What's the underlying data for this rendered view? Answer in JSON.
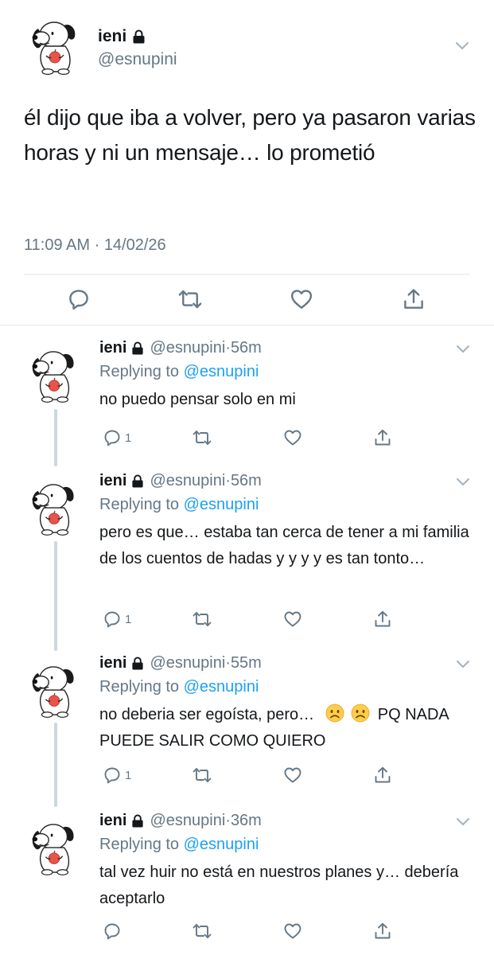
{
  "main_tweet": {
    "name": "ieni",
    "handle": "@esnupini",
    "text": "él dijo que iba a volver, pero ya pasaron varias horas y ni un mensaje… lo prometió",
    "time": "11:09 AM",
    "separator": " · ",
    "date": "14/02/26"
  },
  "replies": [
    {
      "name": "ieni",
      "handle": "@esnupini",
      "dot": "·",
      "time": "56m",
      "replying_prefix": "Replying to ",
      "replying_to": "@esnupini",
      "text": "no puedo pensar solo en mi",
      "reply_count": "1"
    },
    {
      "name": "ieni",
      "handle": "@esnupini",
      "dot": "·",
      "time": "56m",
      "replying_prefix": "Replying to ",
      "replying_to": "@esnupini",
      "text": "pero es que… estaba tan cerca de tener a mi familia de los cuentos de hadas y y y y es tan tonto…",
      "reply_count": "1"
    },
    {
      "name": "ieni",
      "handle": "@esnupini",
      "dot": "·",
      "time": "55m",
      "replying_prefix": "Replying to ",
      "replying_to": "@esnupini",
      "text_before": "no deberia ser egoísta, pero…",
      "text_after": "PQ NADA PUEDE SALIR COMO QUIERO",
      "reply_count": "1"
    },
    {
      "name": "ieni",
      "handle": "@esnupini",
      "dot": "·",
      "time": "36m",
      "replying_prefix": "Replying to ",
      "replying_to": "@esnupini",
      "text": "tal vez huir no está en nuestros planes y… debería aceptarlo",
      "reply_count": ""
    }
  ],
  "icons": {
    "reply": "comment-icon",
    "retweet": "retweet-icon",
    "like": "heart-icon",
    "share": "share-icon",
    "lock": "lock-icon",
    "caret": "chevron-down-icon",
    "emoji": "frowning-face-emoji"
  },
  "colors": {
    "text": "#14171a",
    "secondary": "#657786",
    "link": "#1da1f2",
    "divider": "#e1e8ed",
    "thread_line": "#ccd6dd"
  }
}
